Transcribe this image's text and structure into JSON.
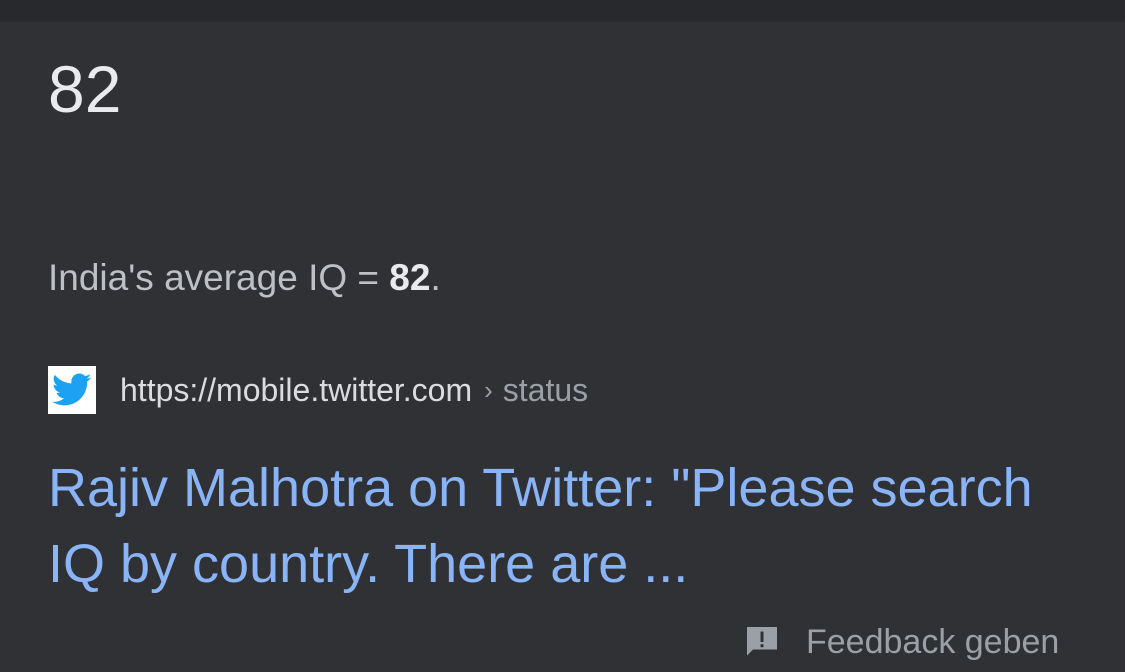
{
  "answer": {
    "value": "82"
  },
  "snippet": {
    "prefix": "India's average IQ = ",
    "bold": "82",
    "suffix": "."
  },
  "source": {
    "favicon": "twitter-bird-icon",
    "url": "https://mobile.twitter.com",
    "separator": "›",
    "breadcrumb": "status"
  },
  "result": {
    "title": "Rajiv Malhotra on Twitter: \"Please search IQ by country. There are ..."
  },
  "feedback": {
    "icon": "feedback-icon",
    "label": "Feedback geben"
  },
  "colors": {
    "background": "#303134",
    "link": "#8ab4f8",
    "twitter_blue": "#1da1f2"
  }
}
